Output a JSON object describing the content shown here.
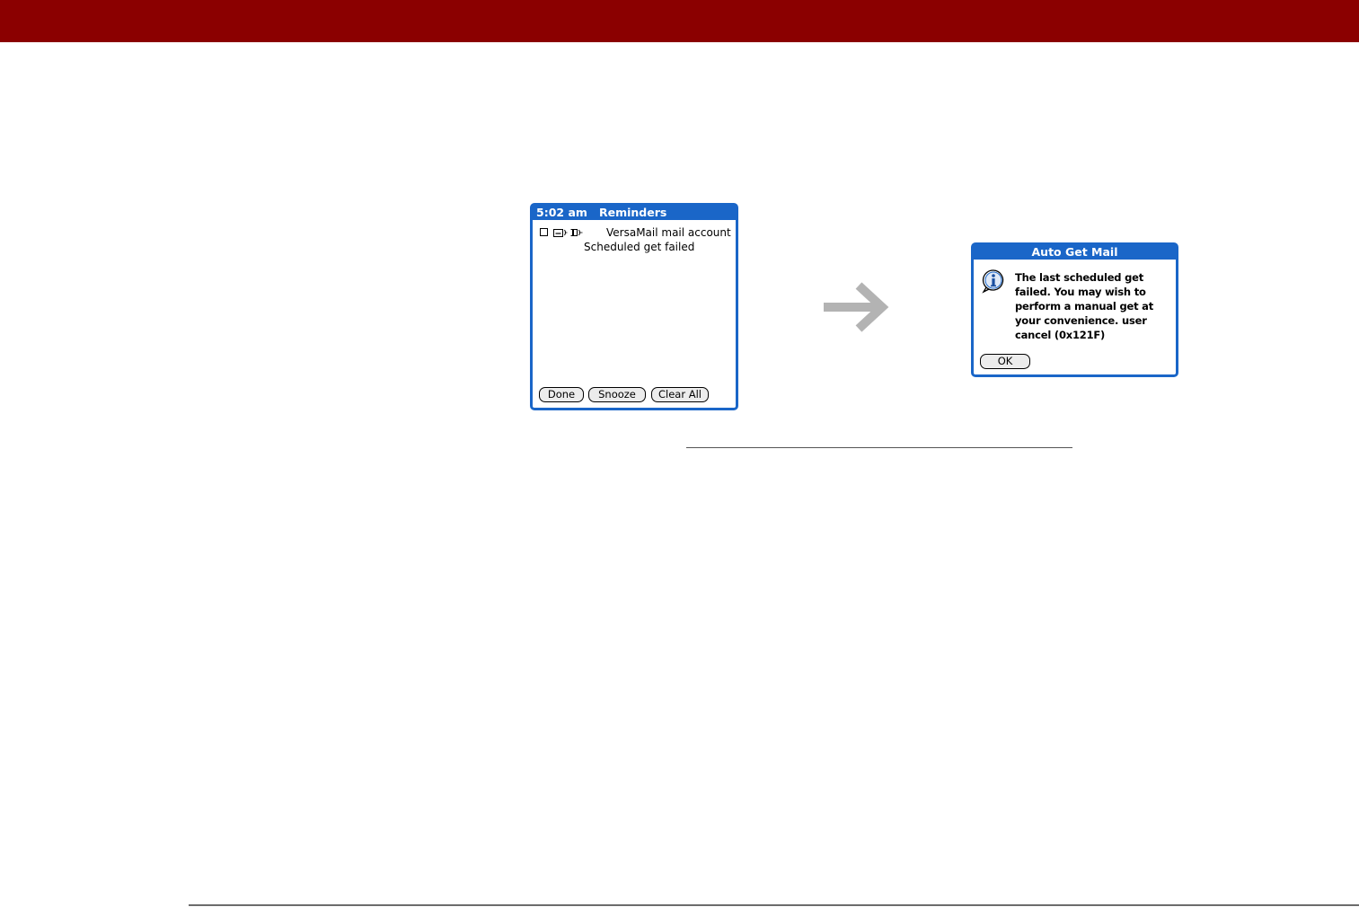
{
  "reminders": {
    "time": "5:02 am",
    "title": "Reminders",
    "item": {
      "line1": "VersaMail mail account",
      "line2": "Scheduled get failed",
      "icons": [
        "checkbox",
        "mail-icon",
        "sound-icon"
      ]
    },
    "buttons": {
      "done": "Done",
      "snooze": "Snooze",
      "clear_all": "Clear All"
    }
  },
  "arrow": {
    "icon": "right-arrow-icon",
    "color": "#b3b3b3"
  },
  "dialog": {
    "title": "Auto Get Mail",
    "icon": "info-icon",
    "message": "The last scheduled get failed.  You may wish to perform a manual get at your convenience.  user cancel (0x121F)",
    "ok_label": "OK"
  },
  "colors": {
    "header_bar": "#8b0000",
    "palm_blue": "#1a66c8"
  }
}
